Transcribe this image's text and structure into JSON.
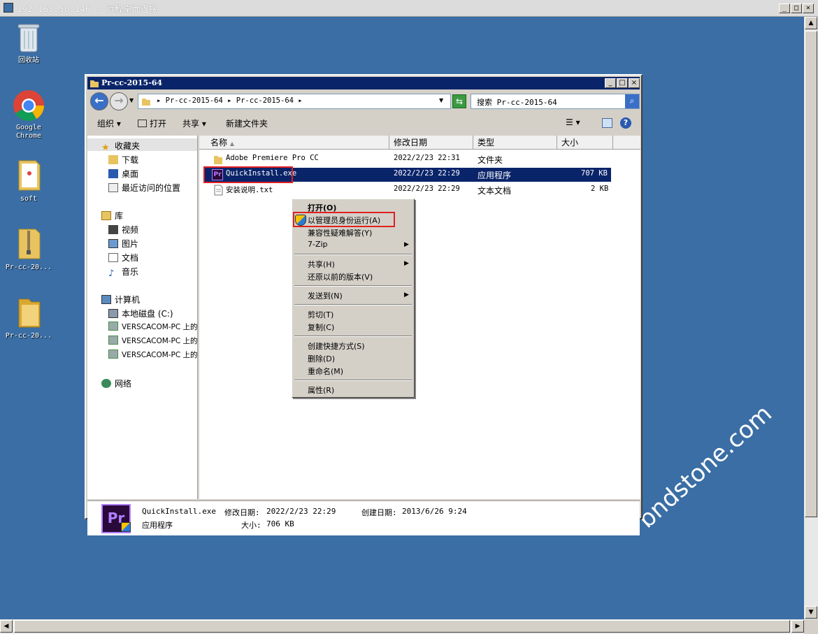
{
  "rdp": {
    "title": "192.168.50.146 - 远程桌面连接",
    "min": "_",
    "max": "□",
    "close": "×"
  },
  "desktop_icons": [
    {
      "label": "回收站",
      "icon": "recycle-bin-icon"
    },
    {
      "label": "Google\nChrome",
      "icon": "chrome-icon"
    },
    {
      "label": "soft",
      "icon": "folder-icon"
    },
    {
      "label": "Pr-cc-20...",
      "icon": "zip-folder-icon"
    },
    {
      "label": "Pr-cc-20...",
      "icon": "folder-icon"
    }
  ],
  "window": {
    "title": "Pr-cc-2015-64"
  },
  "address": {
    "path": "▸ Pr-cc-2015-64 ▸ Pr-cc-2015-64 ▸",
    "search_placeholder": "搜索 Pr-cc-2015-64"
  },
  "toolbar": {
    "organize": "组织",
    "open": "打开",
    "share": "共享",
    "new_folder": "新建文件夹"
  },
  "nav": {
    "favorites": "收藏夹",
    "downloads": "下载",
    "desktop": "桌面",
    "recent": "最近访问的位置",
    "libraries": "库",
    "videos": "视频",
    "pictures": "图片",
    "documents": "文档",
    "music": "音乐",
    "computer": "计算机",
    "local_disk": "本地磁盘 (C:)",
    "net1": "VERSCACOM-PC 上的",
    "net2": "VERSCACOM-PC 上的",
    "net3": "VERSCACOM-PC 上的",
    "network": "网络"
  },
  "columns": {
    "name": "名称",
    "modified": "修改日期",
    "type": "类型",
    "size": "大小"
  },
  "files": [
    {
      "name": "Adobe Premiere Pro CC",
      "modified": "2022/2/23 22:31",
      "type": "文件夹",
      "size": ""
    },
    {
      "name": "QuickInstall.exe",
      "modified": "2022/2/23 22:29",
      "type": "应用程序",
      "size": "707 KB"
    },
    {
      "name": "安装说明.txt",
      "modified": "2022/2/23 22:29",
      "type": "文本文档",
      "size": "2 KB"
    }
  ],
  "menu": {
    "open": "打开(O)",
    "run_as_admin": "以管理员身份运行(A)",
    "compat": "兼容性疑难解答(Y)",
    "zip": "7-Zip",
    "share": "共享(H)",
    "restore": "还原以前的版本(V)",
    "sendto": "发送到(N)",
    "cut": "剪切(T)",
    "copy": "复制(C)",
    "shortcut": "创建快捷方式(S)",
    "delete": "删除(D)",
    "rename": "重命名(M)",
    "properties": "属性(R)"
  },
  "details": {
    "filename": "QuickInstall.exe",
    "modified_label": "修改日期:",
    "modified": "2022/2/23 22:29",
    "created_label": "创建日期:",
    "created": "2013/6/26 9:24",
    "type": "应用程序",
    "size_label": "大小:",
    "size": "706 KB"
  },
  "watermark": "bndstone.com",
  "colors": {
    "desktop": "#3a6ea5",
    "titlebar": "#0a246a",
    "highlight": "#e02020"
  }
}
